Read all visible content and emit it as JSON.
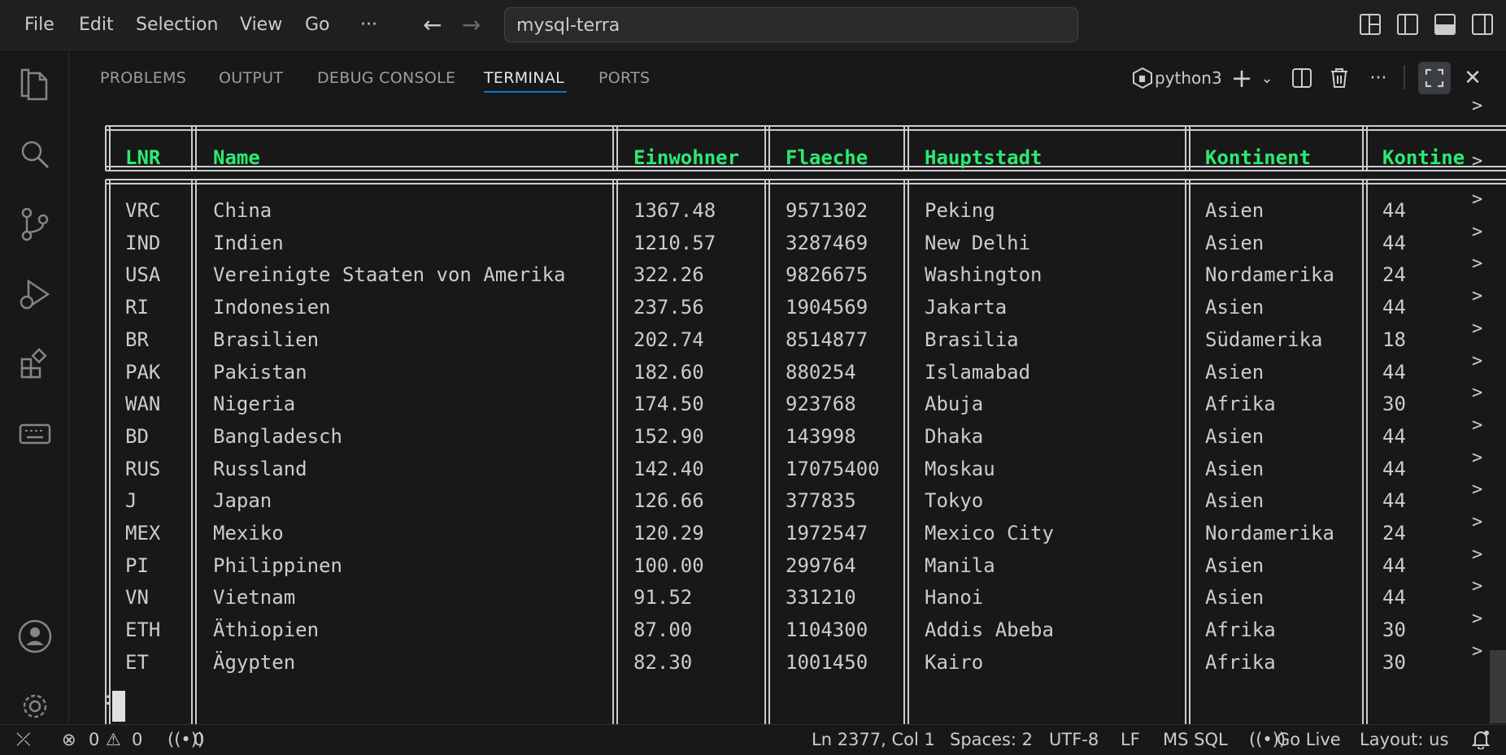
{
  "menu": [
    "File",
    "Edit",
    "Selection",
    "View",
    "Go",
    "···"
  ],
  "command_center": "mysql-terra",
  "panel": {
    "tabs": [
      "PROBLEMS",
      "OUTPUT",
      "DEBUG CONSOLE",
      "TERMINAL",
      "PORTS"
    ],
    "active_tab": "TERMINAL",
    "terminal_name": "python3"
  },
  "table": {
    "headers": [
      "LNR",
      "Name",
      "Einwohner",
      "Flaeche",
      "Hauptstadt",
      "Kontinent",
      "Kontine"
    ],
    "rows": [
      [
        "VRC",
        "China",
        "1367.48",
        "9571302",
        "Peking",
        "Asien",
        "44"
      ],
      [
        "IND",
        "Indien",
        "1210.57",
        "3287469",
        "New Delhi",
        "Asien",
        "44"
      ],
      [
        "USA",
        "Vereinigte Staaten von Amerika",
        "322.26",
        "9826675",
        "Washington",
        "Nordamerika",
        "24"
      ],
      [
        "RI",
        "Indonesien",
        "237.56",
        "1904569",
        "Jakarta",
        "Asien",
        "44"
      ],
      [
        "BR",
        "Brasilien",
        "202.74",
        "8514877",
        "Brasilia",
        "Südamerika",
        "18"
      ],
      [
        "PAK",
        "Pakistan",
        "182.60",
        "880254",
        "Islamabad",
        "Asien",
        "44"
      ],
      [
        "WAN",
        "Nigeria",
        "174.50",
        "923768",
        "Abuja",
        "Afrika",
        "30"
      ],
      [
        "BD",
        "Bangladesch",
        "152.90",
        "143998",
        "Dhaka",
        "Asien",
        "44"
      ],
      [
        "RUS",
        "Russland",
        "142.40",
        "17075400",
        "Moskau",
        "Asien",
        "44"
      ],
      [
        "J",
        "Japan",
        "126.66",
        "377835",
        "Tokyo",
        "Asien",
        "44"
      ],
      [
        "MEX",
        "Mexiko",
        "120.29",
        "1972547",
        "Mexico City",
        "Nordamerika",
        "24"
      ],
      [
        "PI",
        "Philippinen",
        "100.00",
        "299764",
        "Manila",
        "Asien",
        "44"
      ],
      [
        "VN",
        "Vietnam",
        "91.52",
        "331210",
        "Hanoi",
        "Asien",
        "44"
      ],
      [
        "ETH",
        "Äthiopien",
        "87.00",
        "1104300",
        "Addis Abeba",
        "Afrika",
        "30"
      ],
      [
        "ET",
        "Ägypten",
        "82.30",
        "1001450",
        "Kairo",
        "Afrika",
        "30"
      ]
    ],
    "overflow_marker": ">",
    "prompt": ":"
  },
  "status": {
    "problems_errors": "0",
    "problems_warnings": "0",
    "ports": "0",
    "position": "Ln 2377, Col 1",
    "spaces": "Spaces: 2",
    "encoding": "UTF-8",
    "eol": "LF",
    "language": "MS SQL",
    "go_live": "Go Live",
    "layout": "Layout: us"
  },
  "colors": {
    "header_text": "#2bea74",
    "accent": "#0078d4",
    "background": "#181818"
  }
}
